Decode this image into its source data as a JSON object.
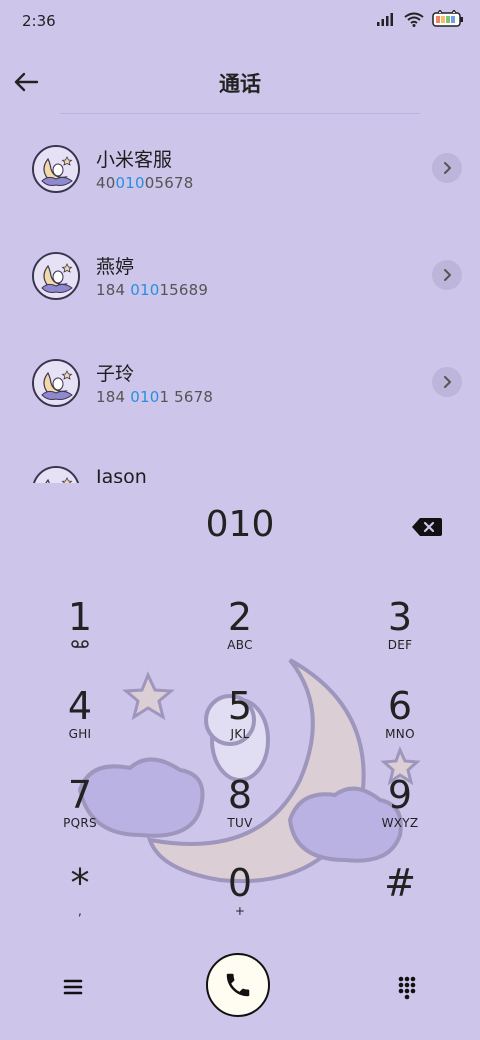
{
  "status": {
    "time": "2:36",
    "icons": [
      "signal-icon",
      "wifi-icon",
      "battery-icon"
    ]
  },
  "header": {
    "title": "通话",
    "back_icon": "arrow-left-icon"
  },
  "contacts": [
    {
      "name": "小米客服",
      "num_pre": "40",
      "num_hl": "010",
      "num_post": "05678"
    },
    {
      "name": "燕婷",
      "num_pre": "184 ",
      "num_hl": "010",
      "num_post": "15689"
    },
    {
      "name": "子玲",
      "num_pre": "184 ",
      "num_hl": "010",
      "num_post": "1 5678"
    },
    {
      "name": "Jason",
      "num_pre": "",
      "num_hl": "",
      "num_post": ""
    }
  ],
  "dialer": {
    "input": "010",
    "keys": [
      {
        "digit": "1",
        "sub": "voicemail"
      },
      {
        "digit": "2",
        "sub": "ABC"
      },
      {
        "digit": "3",
        "sub": "DEF"
      },
      {
        "digit": "4",
        "sub": "GHI"
      },
      {
        "digit": "5",
        "sub": "JKL"
      },
      {
        "digit": "6",
        "sub": "MNO"
      },
      {
        "digit": "7",
        "sub": "PQRS"
      },
      {
        "digit": "8",
        "sub": "TUV"
      },
      {
        "digit": "9",
        "sub": "WXYZ"
      },
      {
        "digit": "*",
        "sub": ","
      },
      {
        "digit": "0",
        "sub": "+"
      },
      {
        "digit": "#",
        "sub": ""
      }
    ]
  },
  "bottom": {
    "menu_icon": "menu-icon",
    "call_icon": "phone-icon",
    "keypad_icon": "keypad-icon"
  },
  "colors": {
    "background": "#cdc6ea",
    "highlight": "#2a8ee0",
    "chevron_bg": "#bdb6da",
    "call_button": "#fffdf2"
  }
}
